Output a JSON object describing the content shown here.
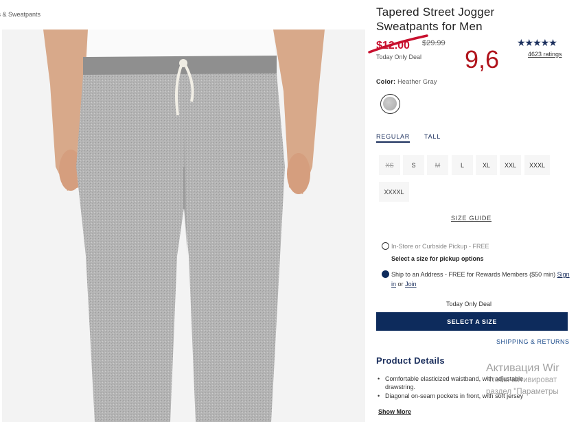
{
  "breadcrumb": {
    "text": "rts & Sweatpants"
  },
  "product": {
    "title": "Tapered Street Jogger Sweatpants for Men",
    "sale_price": "$12.00",
    "original_price": "$29.99",
    "deal_label": "Today Only Deal",
    "rating_stars": "★★★★★",
    "ratings_count": "4623 ratings",
    "annotation": "9,6"
  },
  "color": {
    "label": "Color:",
    "name": "Heather Gray"
  },
  "fit_tabs": [
    {
      "label": "REGULAR"
    },
    {
      "label": "TALL"
    }
  ],
  "sizes": [
    {
      "label": "XS",
      "available": false
    },
    {
      "label": "S",
      "available": true
    },
    {
      "label": "M",
      "available": false
    },
    {
      "label": "L",
      "available": true
    },
    {
      "label": "XL",
      "available": true
    },
    {
      "label": "XXL",
      "available": true
    },
    {
      "label": "XXXL",
      "available": true
    },
    {
      "label": "XXXXL",
      "available": true
    }
  ],
  "size_guide": "SIZE GUIDE",
  "fulfillment": {
    "pickup": "In-Store or Curbside Pickup - FREE",
    "pickup_hint": "Select a size for pickup options",
    "ship_prefix": "Ship to an Address - FREE for Rewards Members ($50 min)",
    "sign_in": "Sign in",
    "or": "or",
    "join": "Join"
  },
  "deal_center": "Today Only Deal",
  "select_size_button": "SELECT A SIZE",
  "shipping_returns": "SHIPPING & RETURNS",
  "details": {
    "heading": "Product Details",
    "items": [
      "Comfortable elasticized waistband, with adjustable drawstring.",
      "Diagonal on-seam pockets in front, with soft jersey"
    ],
    "show_more": "Show More"
  },
  "windows_activation": {
    "title": "Активация Wir",
    "line1": "Чтобы активироват",
    "line2": "раздел \"Параметры"
  }
}
